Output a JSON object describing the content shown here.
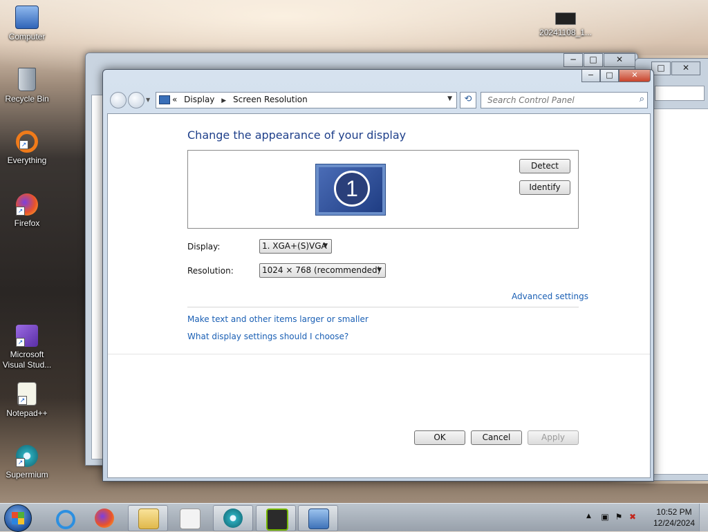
{
  "desktop": {
    "icons": [
      {
        "label": "Computer"
      },
      {
        "label": "Recycle Bin"
      },
      {
        "label": "Everything"
      },
      {
        "label": "Firefox"
      },
      {
        "label": "Microsoft Visual Stud..."
      },
      {
        "label": "Notepad++"
      },
      {
        "label": "Supermium"
      },
      {
        "label": "20241108_1..."
      }
    ]
  },
  "window": {
    "breadcrumb_prefix": "«",
    "breadcrumb": [
      "Display",
      "Screen Resolution"
    ],
    "search_placeholder": "Search Control Panel",
    "title": "Change the appearance of your display",
    "monitor_number": "1",
    "detect_label": "Detect",
    "identify_label": "Identify",
    "display_label": "Display:",
    "display_value": "1. XGA+(S)VGA",
    "resolution_label": "Resolution:",
    "resolution_value": "1024 × 768 (recommended)",
    "advanced_settings": "Advanced settings",
    "link_text_size": "Make text and other items larger or smaller",
    "link_help": "What display settings should I choose?",
    "ok_label": "OK",
    "cancel_label": "Cancel",
    "apply_label": "Apply",
    "title_buttons": {
      "min": "−",
      "max": "□",
      "close": "✕"
    }
  },
  "taskbar": {
    "clock_time": "10:52 PM",
    "clock_date": "12/24/2024",
    "pinned": [
      "internet-explorer",
      "firefox",
      "file-explorer",
      "media-player",
      "supermium",
      "nvidia",
      "display-control-panel"
    ]
  }
}
